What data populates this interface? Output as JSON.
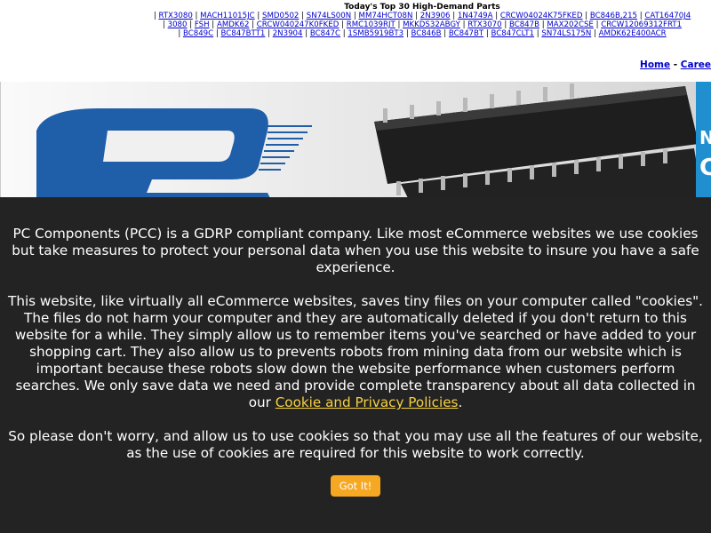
{
  "header": {
    "title": "Today's Top 30 High-Demand Parts",
    "parts_rows": [
      [
        "RTX3080",
        "MACH11015JC",
        "SMD0502",
        "SN74LS00N",
        "MM74HCT08N",
        "2N3906",
        "1N4749A",
        "CRCW04024K75FKED",
        "BC846B,215",
        "CAT16470J4"
      ],
      [
        "3080",
        "FSH",
        "AMDK62",
        "CRCW040247K0FKED",
        "RMC1039RJT",
        "MKKDS32ABGY",
        "RTX3070",
        "BC847B",
        "MAX202CSE",
        "CRCW12069312FRT1"
      ],
      [
        "BC849C",
        "BC847BTT1",
        "2N3904",
        "BC847C",
        "1SMB5919BT3",
        "BC846B",
        "BC847BT",
        "BC847CLT1",
        "SN74LS175N",
        "AMDK62E400ACR"
      ]
    ]
  },
  "nav": {
    "home": "Home",
    "separator": "-",
    "careers": "Caree"
  },
  "banner": {
    "side_text_1": "N",
    "side_text_2": "C"
  },
  "cookie_notice": {
    "paragraph1": "PC Components (PCC) is a GDRP compliant company. Like most eCommerce websites we use cookies but take measures to protect your personal data when you use this website to insure you have a safe experience.",
    "paragraph2_text": "This website, like virtually all eCommerce websites, saves tiny files on your computer called \"cookies\". The files do not harm your computer and they are automatically deleted if you don't return to this website for a while. They simply allow us to remember items you've searched or have added to your shopping cart. They also allow us to prevents robots from mining data from our website which is important because these robots slow down the website performance when customers perform searches. We only save data we need and provide complete transparency about all data collected in our",
    "policy_link": "Cookie and Privacy Policies",
    "paragraph2_end": ".",
    "paragraph3": "So please don't worry, and allow us to use cookies so that you may use all the features of our website, as the use of cookies are required for this website to work correctly.",
    "button_label": "Got It!"
  },
  "colors": {
    "overlay": "#232323",
    "button": "#f7a823",
    "link": "#f5d142",
    "nav_link": "#0000cc"
  }
}
